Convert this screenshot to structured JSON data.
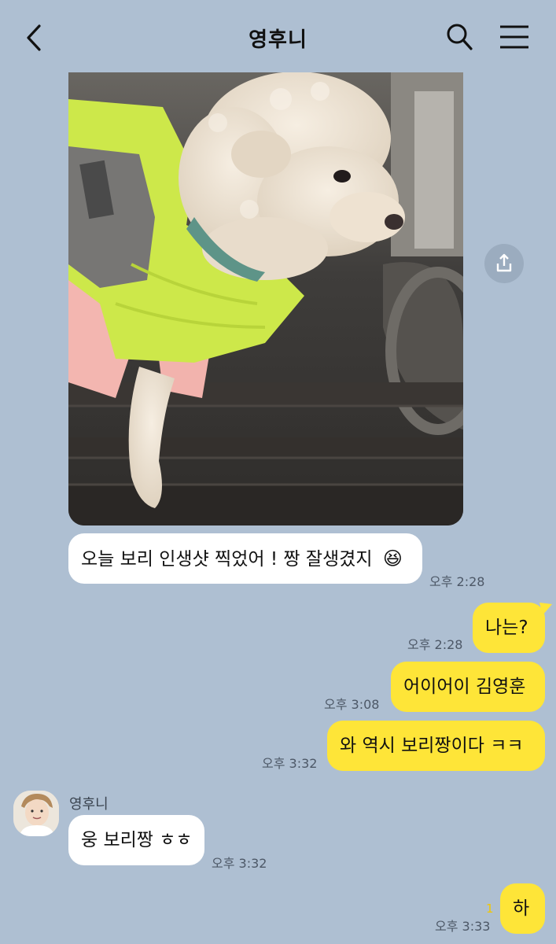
{
  "header": {
    "title": "영후니"
  },
  "messages": [
    {
      "side": "in",
      "text": "오늘 보리 인생샷 찍었어 ! 짱 잘생겼지",
      "emoji": "😆",
      "time": "오후 2:28"
    },
    {
      "side": "out",
      "text": "나는?",
      "time": "오후 2:28"
    },
    {
      "side": "out",
      "text": "어이어이 김영훈",
      "time": "오후 3:08"
    },
    {
      "side": "out",
      "text": "와 역시 보리짱이다 ㅋㅋ",
      "time": "오후 3:32"
    },
    {
      "side": "in",
      "sender": "영후니",
      "text": "웅 보리짱 ㅎㅎ",
      "time": "오후 3:32"
    },
    {
      "side": "out",
      "text": "하",
      "unread": "1",
      "time": "오후 3:33"
    }
  ],
  "colors": {
    "background": "#aebfd2",
    "outgoing_bubble": "#fee538",
    "incoming_bubble": "#ffffff",
    "unread_count": "#f2c700"
  },
  "icons": {
    "back": "chevron-left-icon",
    "search": "search-icon",
    "menu": "hamburger-menu-icon",
    "share": "share-icon"
  }
}
